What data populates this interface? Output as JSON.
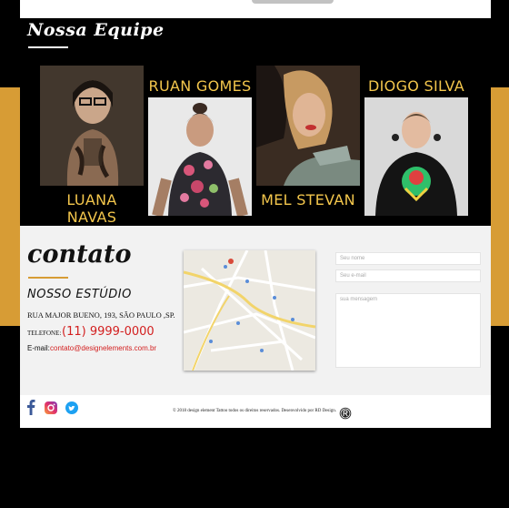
{
  "team": {
    "title": "Nossa Equipe",
    "members": [
      {
        "name": "LUANA NAVAS"
      },
      {
        "name": "RUAN GOMES"
      },
      {
        "name": "MEL STEVAN"
      },
      {
        "name": "DIOGO SILVA"
      }
    ]
  },
  "contact": {
    "title": "contato",
    "studio_title": "NOSSO ESTÚDIO",
    "address": "RUA MAJOR BUENO, 193, SÃO PAULO ,SP.",
    "phone_label": "TELEFONE:",
    "phone": "(11) 9999-0000",
    "email_label": "E-mail:",
    "email": "contato@designelements.com.br"
  },
  "form": {
    "name_placeholder": "Seu nome",
    "email_placeholder": "Seu e-mail",
    "message_placeholder": "sua mensagem"
  },
  "footer": {
    "copyright": "© 2018 design element Tattoo todos os direitos reservados. Desenvolvido por RD Design."
  },
  "colors": {
    "gold": "#d79c35",
    "name_yellow": "#f3c64c",
    "accent_red": "#d32020",
    "facebook": "#3b5998",
    "twitter": "#1da1f2"
  },
  "icons": [
    "facebook-icon",
    "instagram-icon",
    "twitter-icon",
    "rd-design-logo-icon"
  ]
}
